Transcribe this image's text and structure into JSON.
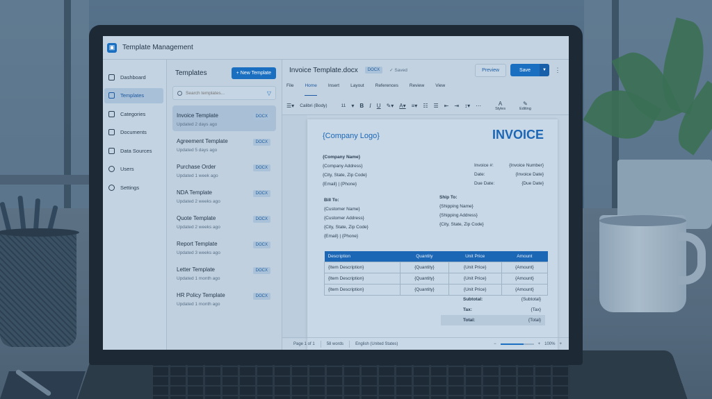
{
  "app": {
    "title": "Template Management",
    "logo": "app-logo-icon"
  },
  "nav": {
    "items": [
      {
        "label": "Dashboard",
        "icon": "home-icon"
      },
      {
        "label": "Templates",
        "icon": "template-icon",
        "active": true
      },
      {
        "label": "Categories",
        "icon": "categories-icon"
      },
      {
        "label": "Documents",
        "icon": "document-icon"
      },
      {
        "label": "Data Sources",
        "icon": "database-icon"
      },
      {
        "label": "Users",
        "icon": "user-icon"
      },
      {
        "label": "Settings",
        "icon": "gear-icon"
      }
    ]
  },
  "templates": {
    "title": "Templates",
    "new_button": "+ New Template",
    "search_placeholder": "Search templates...",
    "items": [
      {
        "name": "Invoice Template",
        "updated": "Updated 2 days ago",
        "type": "DOCX"
      },
      {
        "name": "Agreement Template",
        "updated": "Updated 5 days ago",
        "type": "DOCX"
      },
      {
        "name": "Purchase Order",
        "updated": "Updated 1 week ago",
        "type": "DOCX"
      },
      {
        "name": "NDA Template",
        "updated": "Updated 2 weeks ago",
        "type": "DOCX"
      },
      {
        "name": "Quote Template",
        "updated": "Updated 2 weeks ago",
        "type": "DOCX"
      },
      {
        "name": "Report Template",
        "updated": "Updated 3 weeks ago",
        "type": "DOCX"
      },
      {
        "name": "Letter Template",
        "updated": "Updated 1 month ago",
        "type": "DOCX"
      },
      {
        "name": "HR Policy Template",
        "updated": "Updated 1 month ago",
        "type": "DOCX"
      }
    ]
  },
  "editor": {
    "doc_name": "Invoice Template.docx",
    "doc_type": "DOCX",
    "saved": "Saved",
    "preview": "Preview",
    "save": "Save",
    "menu": [
      "File",
      "Home",
      "Insert",
      "Layout",
      "References",
      "Review",
      "View"
    ],
    "font": "Calibri (Body)",
    "font_size": "11",
    "styles": "Styles",
    "editing": "Editing"
  },
  "document": {
    "logo": "{Company Logo}",
    "title": "INVOICE",
    "company": [
      "{Company Name}",
      "{Company Address}",
      "{City, State, Zip Code}",
      "{Email} | {Phone}"
    ],
    "meta": [
      {
        "label": "Invoice #:",
        "value": "{Invoice Number}"
      },
      {
        "label": "Date:",
        "value": "{Invoice Date}"
      },
      {
        "label": "Due Date:",
        "value": "{Due Date}"
      }
    ],
    "bill_to_label": "Bill To:",
    "bill_to": [
      "{Customer Name}",
      "{Customer Address}",
      "{City, State, Zip Code}",
      "{Email} | {Phone}"
    ],
    "ship_to_label": "Ship To:",
    "ship_to": [
      "{Shipping Name}",
      "{Shipping Address}",
      "{City, State, Zip Code}"
    ],
    "table_headers": [
      "Description",
      "Quantity",
      "Unit Price",
      "Amount"
    ],
    "table_rows": [
      [
        "{Item Description}",
        "{Quantity}",
        "{Unit Price}",
        "{Amount}"
      ],
      [
        "{Item Description}",
        "{Quantity}",
        "{Unit Price}",
        "{Amount}"
      ],
      [
        "{Item Description}",
        "{Quantity}",
        "{Unit Price}",
        "{Amount}"
      ]
    ],
    "totals": [
      {
        "label": "Subtotal:",
        "value": "{Subtotal}"
      },
      {
        "label": "Tax:",
        "value": "{Tax}"
      },
      {
        "label": "Total:",
        "value": "{Total}"
      }
    ]
  },
  "status": {
    "page": "Page 1 of 1",
    "words": "58 words",
    "language": "English (United States)",
    "zoom": "100%",
    "zoom_level": 0.7
  }
}
